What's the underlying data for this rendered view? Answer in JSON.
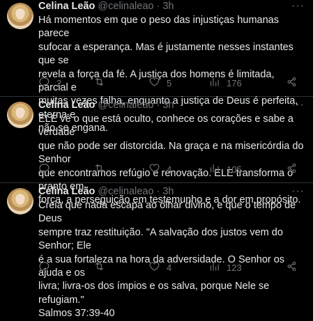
{
  "tweets": [
    {
      "author": "Celina Leão",
      "handle": "@celinaleao",
      "separator": "·",
      "time": "3h",
      "text": "Há momentos em que o peso das injustiças humanas parece\nsufocar a esperança. Mas é justamente nesses instantes que se\nrevela a força da fé. A justiça dos homens é limitada, parcial e\nmuitas vezes falha, enquanto a justiça de Deus é perfeita, eterna e\nnão se engana.",
      "replies": "2",
      "retweets": "",
      "likes": "5",
      "views": "176"
    },
    {
      "author": "Celina Leão",
      "handle": "@celinaleao",
      "separator": "·",
      "time": "3h",
      "text": "ELE vê o que está oculto, conhece os corações e sabe a verdade\nque não pode ser distorcida. Na graça e na misericórdia do Senhor\nque encontramos refúgio e renovação. ELE transforma o pranto em\nforça, a perseguição em testemunho e a dor em propósito.",
      "replies": "",
      "retweets": "",
      "likes": "4",
      "views": "105"
    },
    {
      "author": "Celina Leão",
      "handle": "@celinaleao",
      "separator": "·",
      "time": "3h",
      "text": "Creia que nada escapa ao olhar divino, e que o tempo de Deus\nsempre traz restituição. \"A salvação dos justos vem do Senhor; Ele\né a sua fortaleza na hora da adversidade. O Senhor os ajuda e os\nlivra; livra-os dos ímpios e os salva, porque Nele se refugiam.\"\nSalmos 37:39-40",
      "replies": "",
      "retweets": "",
      "likes": "4",
      "views": "123"
    }
  ],
  "icons": {
    "more": "more-icon",
    "reply": "reply-icon",
    "retweet": "retweet-icon",
    "like": "heart-icon",
    "views": "views-icon",
    "share": "share-icon"
  },
  "more_glyph": "···",
  "colors": {
    "background": "#000000",
    "text": "#e7e9ea",
    "secondary": "#71767b",
    "divider": "#2f3336"
  }
}
